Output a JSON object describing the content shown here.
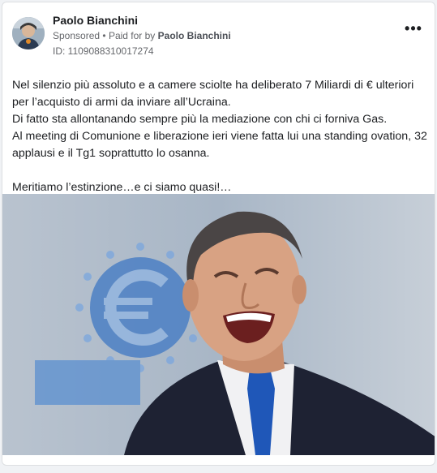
{
  "post": {
    "author": "Paolo Bianchini",
    "sponsored_label": "Sponsored",
    "separator": "•",
    "paid_for_prefix": "Paid for by",
    "paid_for_name": "Paolo Bianchini",
    "ad_id": "ID: 1109088310017274",
    "more_icon": "more-horizontal-icon",
    "more_label": "•••",
    "body": {
      "line1": "Nel silenzio più assoluto e a camere sciolte ha deliberato 7 Miliardi di € ulteriori per l’acquisto di armi da inviare all’Ucraina.",
      "line2": "Di fatto sta allontanando sempre più la mediazione con chi ci forniva Gas.",
      "line3": "Al meeting di Comunione e liberazione ieri viene fatta lui una standing ovation, 32 applausi e il Tg1 soprattutto lo osanna.",
      "line4": "Meritiamo l’estinzione…e ci siamo quasi!…"
    }
  },
  "colors": {
    "background": "#f0f2f5",
    "card": "#ffffff",
    "text": "#1c1e21",
    "muted": "#65676b"
  }
}
